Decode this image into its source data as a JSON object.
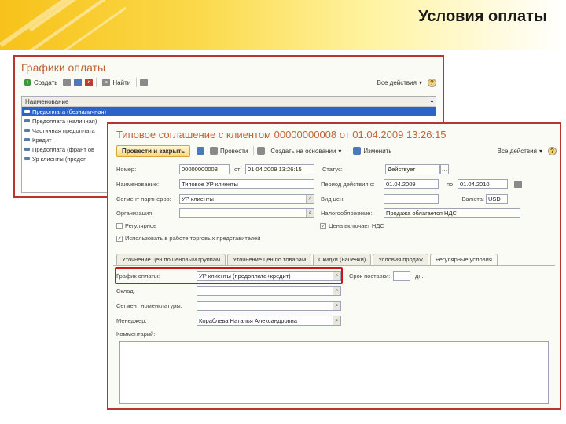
{
  "slide": {
    "title": "Условия оплаты"
  },
  "list_window": {
    "title": "Графики оплаты",
    "toolbar": {
      "add_label": "Создать",
      "find_label": "Найти",
      "all_actions_label": "Все действия"
    },
    "list": {
      "column_header": "Наименование",
      "rows": [
        "Предоплата (безналичная)",
        "Предоплата (наличная)",
        "Частичная предоплата",
        "Кредит",
        "Предоплата (франт ов",
        "Ур клиенты (предоп"
      ]
    }
  },
  "form_window": {
    "title": "Типовое соглашение с клиентом 00000000008 от 01.04.2009 13:26:15",
    "toolbar": {
      "post_close_label": "Провести и закрыть",
      "post_label": "Провести",
      "create_on_basis_label": "Создать на основании",
      "change_label": "Изменить",
      "all_actions_label": "Все действия"
    },
    "fields": {
      "number_label": "Номер:",
      "number_value": "00000000008",
      "date_label": "от:",
      "date_value": "01.04.2009 13:26:15",
      "status_label": "Статус:",
      "status_value": "Действует",
      "name_label": "Наименование:",
      "name_value": "Типовое УР клиенты",
      "period_label": "Период действия с:",
      "period_from": "01.04.2009",
      "period_to_label": "по",
      "period_to": "01.04.2010",
      "segment_label": "Сегмент партнеров:",
      "segment_value": "УР клиенты",
      "price_label": "Вид цен:",
      "price_value": "",
      "currency_label": "Валюта:",
      "currency_value": "USD",
      "org_label": "Организация:",
      "org_value": "",
      "tax_label": "Налогообложение:",
      "tax_value": "Продажа облагается НДС",
      "regular_label": "Регулярное",
      "price_incl_label": "Цена включает НДС",
      "trade_rep_label": "Использовать в работе торговых представителей"
    },
    "tabs": [
      "Уточнение цен по ценовым группам",
      "Уточнение цен по товарам",
      "Скидки (наценки)",
      "Условия продаж",
      "Регулярные условия"
    ],
    "tab_fields": {
      "schedule_label": "График оплаты:",
      "schedule_value": "УР клиенты (предоплата+кредит)",
      "delay_label": "Срок поставки:",
      "delay_unit": "дн.",
      "warehouse_label": "Склад:",
      "warehouse_value": "",
      "nomenclature_segment_label": "Сегмент номенклатуры:",
      "nomenclature_segment_value": "",
      "manager_label": "Менеджер:",
      "manager_value": "Кораблева Наталья Александровна",
      "comment_label": "Комментарий:"
    }
  },
  "colors": {
    "highlight": "#d2121a",
    "window_border": "#b7342f",
    "title_orange": "#c1633a",
    "selection": "#2c63c8"
  }
}
